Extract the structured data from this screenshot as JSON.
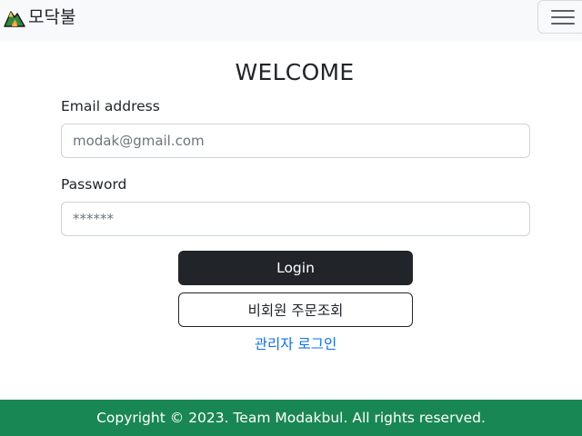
{
  "navbar": {
    "brand_logo_icon": "campfire-mountain-logo-icon",
    "brand_text": "모닥불",
    "menu_icon": "hamburger-menu-icon"
  },
  "login_form": {
    "title": "WELCOME",
    "email": {
      "label": "Email address",
      "placeholder": "modak@gmail.com",
      "value": ""
    },
    "password": {
      "label": "Password",
      "placeholder": "******",
      "value": ""
    },
    "login_button_label": "Login",
    "guest_order_button_label": "비회원 주문조회",
    "admin_login_link": "관리자 로그인"
  },
  "footer": {
    "copyright": "Copyright © 2023. Team Modakbul. All rights reserved."
  },
  "colors": {
    "navbar_bg": "#f8f9fa",
    "primary_button": "#212529",
    "link": "#0d6efd",
    "footer_bg": "#198754"
  }
}
